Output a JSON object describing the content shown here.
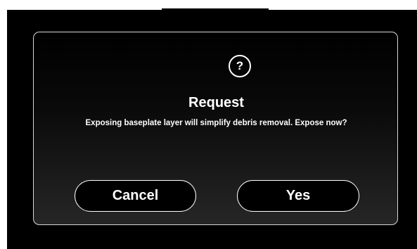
{
  "dialog": {
    "icon": "question-mark-icon",
    "icon_glyph": "?",
    "title": "Request",
    "message": "Exposing baseplate layer will simplify debris removal. Expose now?",
    "buttons": {
      "cancel_label": "Cancel",
      "yes_label": "Yes"
    }
  },
  "colors": {
    "background": "#000000",
    "text": "#ffffff",
    "border": "#d8d8d8"
  }
}
